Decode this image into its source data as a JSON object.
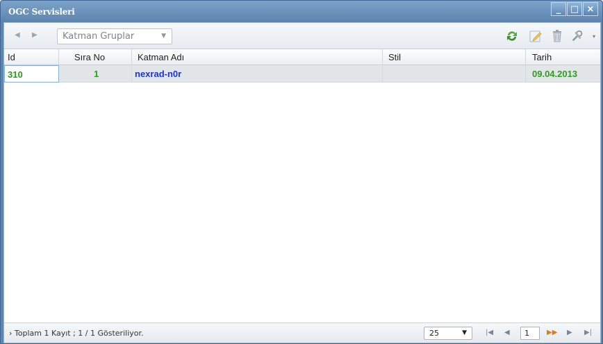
{
  "window": {
    "title": "OGC Servisleri",
    "minimize_glyph": "_",
    "maximize_glyph": "□",
    "close_glyph": "×"
  },
  "toolbar": {
    "back_glyph": "◀",
    "forward_glyph": "▶",
    "combo_value": "Katman Gruplar",
    "combo_arrow": "▼",
    "icons": [
      "refresh-icon",
      "edit-icon",
      "delete-icon",
      "tools-icon"
    ],
    "tools_arrow": "▾"
  },
  "grid": {
    "columns": [
      "Id",
      "Sıra No",
      "Katman Adı",
      "Stil",
      "Tarih"
    ],
    "rows": [
      {
        "id": "310",
        "sira_no": "1",
        "katman_adi": "nexrad-n0r",
        "stil": "",
        "tarih": "09.04.2013"
      }
    ]
  },
  "footer": {
    "summary": "› Toplam 1 Kayıt ; 1 / 1 Gösteriliyor.",
    "page_size": "25",
    "page_size_arrow": "▼",
    "first_glyph": "|◀",
    "prev_glyph": "◀",
    "current_page": "1",
    "next_glyph": "▶▶",
    "next2_glyph": "▶",
    "last_glyph": "▶|"
  },
  "colors": {
    "titlebar": "#5b84ae",
    "green_text": "#2e9b1b",
    "blue_text": "#1a33d6",
    "accent_orange": "#e07a12"
  }
}
